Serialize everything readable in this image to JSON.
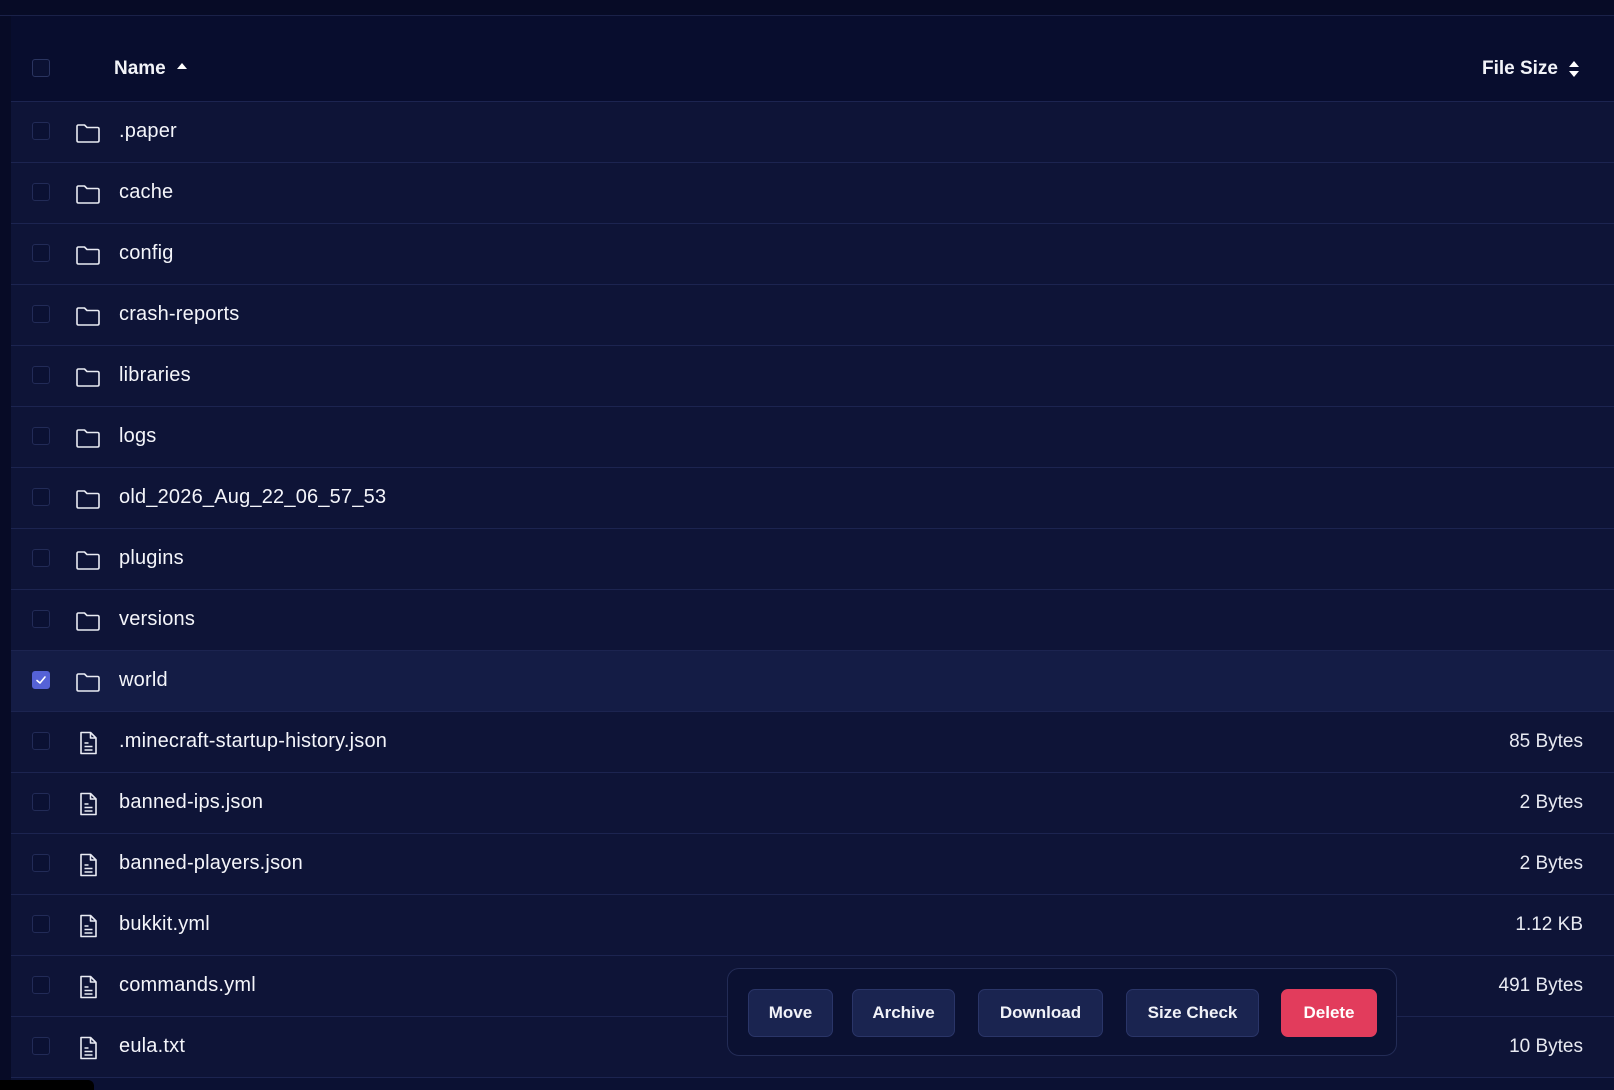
{
  "header": {
    "name_label": "Name",
    "size_label": "File Size"
  },
  "rows": [
    {
      "name": ".paper",
      "type": "folder",
      "size": "",
      "selected": false
    },
    {
      "name": "cache",
      "type": "folder",
      "size": "",
      "selected": false
    },
    {
      "name": "config",
      "type": "folder",
      "size": "",
      "selected": false
    },
    {
      "name": "crash-reports",
      "type": "folder",
      "size": "",
      "selected": false
    },
    {
      "name": "libraries",
      "type": "folder",
      "size": "",
      "selected": false
    },
    {
      "name": "logs",
      "type": "folder",
      "size": "",
      "selected": false
    },
    {
      "name": "old_2026_Aug_22_06_57_53",
      "type": "folder",
      "size": "",
      "selected": false
    },
    {
      "name": "plugins",
      "type": "folder",
      "size": "",
      "selected": false
    },
    {
      "name": "versions",
      "type": "folder",
      "size": "",
      "selected": false
    },
    {
      "name": "world",
      "type": "folder",
      "size": "",
      "selected": true
    },
    {
      "name": ".minecraft-startup-history.json",
      "type": "file",
      "size": "85 Bytes",
      "selected": false
    },
    {
      "name": "banned-ips.json",
      "type": "file",
      "size": "2 Bytes",
      "selected": false
    },
    {
      "name": "banned-players.json",
      "type": "file",
      "size": "2 Bytes",
      "selected": false
    },
    {
      "name": "bukkit.yml",
      "type": "file",
      "size": "1.12 KB",
      "selected": false
    },
    {
      "name": "commands.yml",
      "type": "file",
      "size": "491 Bytes",
      "selected": false
    },
    {
      "name": "eula.txt",
      "type": "file",
      "size": "10 Bytes",
      "selected": false
    }
  ],
  "actions": {
    "move": "Move",
    "archive": "Archive",
    "download": "Download",
    "size_check": "Size Check",
    "delete": "Delete"
  },
  "colors": {
    "accent": "#5562d6",
    "danger": "#e23c5c",
    "background": "#0e1437"
  },
  "icons": {
    "folder": "folder-icon",
    "file": "file-text-icon",
    "sort_asc": "sort-up-icon",
    "sort_both": "sort-both-icon"
  }
}
